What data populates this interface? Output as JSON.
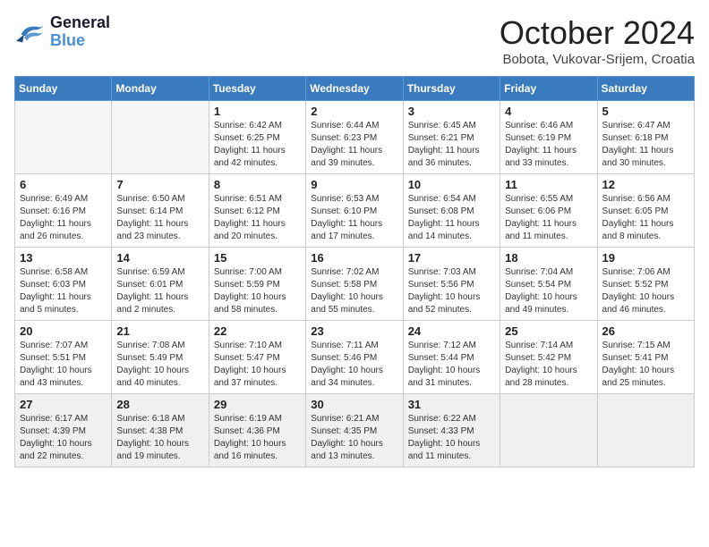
{
  "logo": {
    "line1": "General",
    "line2": "Blue"
  },
  "title": "October 2024",
  "subtitle": "Bobota, Vukovar-Srijem, Croatia",
  "headers": [
    "Sunday",
    "Monday",
    "Tuesday",
    "Wednesday",
    "Thursday",
    "Friday",
    "Saturday"
  ],
  "weeks": [
    [
      {
        "day": "",
        "empty": true
      },
      {
        "day": "",
        "empty": true
      },
      {
        "day": "1",
        "sunrise": "6:42 AM",
        "sunset": "6:25 PM",
        "daylight": "11 hours and 42 minutes."
      },
      {
        "day": "2",
        "sunrise": "6:44 AM",
        "sunset": "6:23 PM",
        "daylight": "11 hours and 39 minutes."
      },
      {
        "day": "3",
        "sunrise": "6:45 AM",
        "sunset": "6:21 PM",
        "daylight": "11 hours and 36 minutes."
      },
      {
        "day": "4",
        "sunrise": "6:46 AM",
        "sunset": "6:19 PM",
        "daylight": "11 hours and 33 minutes."
      },
      {
        "day": "5",
        "sunrise": "6:47 AM",
        "sunset": "6:18 PM",
        "daylight": "11 hours and 30 minutes."
      }
    ],
    [
      {
        "day": "6",
        "sunrise": "6:49 AM",
        "sunset": "6:16 PM",
        "daylight": "11 hours and 26 minutes."
      },
      {
        "day": "7",
        "sunrise": "6:50 AM",
        "sunset": "6:14 PM",
        "daylight": "11 hours and 23 minutes."
      },
      {
        "day": "8",
        "sunrise": "6:51 AM",
        "sunset": "6:12 PM",
        "daylight": "11 hours and 20 minutes."
      },
      {
        "day": "9",
        "sunrise": "6:53 AM",
        "sunset": "6:10 PM",
        "daylight": "11 hours and 17 minutes."
      },
      {
        "day": "10",
        "sunrise": "6:54 AM",
        "sunset": "6:08 PM",
        "daylight": "11 hours and 14 minutes."
      },
      {
        "day": "11",
        "sunrise": "6:55 AM",
        "sunset": "6:06 PM",
        "daylight": "11 hours and 11 minutes."
      },
      {
        "day": "12",
        "sunrise": "6:56 AM",
        "sunset": "6:05 PM",
        "daylight": "11 hours and 8 minutes."
      }
    ],
    [
      {
        "day": "13",
        "sunrise": "6:58 AM",
        "sunset": "6:03 PM",
        "daylight": "11 hours and 5 minutes."
      },
      {
        "day": "14",
        "sunrise": "6:59 AM",
        "sunset": "6:01 PM",
        "daylight": "11 hours and 2 minutes."
      },
      {
        "day": "15",
        "sunrise": "7:00 AM",
        "sunset": "5:59 PM",
        "daylight": "10 hours and 58 minutes."
      },
      {
        "day": "16",
        "sunrise": "7:02 AM",
        "sunset": "5:58 PM",
        "daylight": "10 hours and 55 minutes."
      },
      {
        "day": "17",
        "sunrise": "7:03 AM",
        "sunset": "5:56 PM",
        "daylight": "10 hours and 52 minutes."
      },
      {
        "day": "18",
        "sunrise": "7:04 AM",
        "sunset": "5:54 PM",
        "daylight": "10 hours and 49 minutes."
      },
      {
        "day": "19",
        "sunrise": "7:06 AM",
        "sunset": "5:52 PM",
        "daylight": "10 hours and 46 minutes."
      }
    ],
    [
      {
        "day": "20",
        "sunrise": "7:07 AM",
        "sunset": "5:51 PM",
        "daylight": "10 hours and 43 minutes."
      },
      {
        "day": "21",
        "sunrise": "7:08 AM",
        "sunset": "5:49 PM",
        "daylight": "10 hours and 40 minutes."
      },
      {
        "day": "22",
        "sunrise": "7:10 AM",
        "sunset": "5:47 PM",
        "daylight": "10 hours and 37 minutes."
      },
      {
        "day": "23",
        "sunrise": "7:11 AM",
        "sunset": "5:46 PM",
        "daylight": "10 hours and 34 minutes."
      },
      {
        "day": "24",
        "sunrise": "7:12 AM",
        "sunset": "5:44 PM",
        "daylight": "10 hours and 31 minutes."
      },
      {
        "day": "25",
        "sunrise": "7:14 AM",
        "sunset": "5:42 PM",
        "daylight": "10 hours and 28 minutes."
      },
      {
        "day": "26",
        "sunrise": "7:15 AM",
        "sunset": "5:41 PM",
        "daylight": "10 hours and 25 minutes."
      }
    ],
    [
      {
        "day": "27",
        "sunrise": "6:17 AM",
        "sunset": "4:39 PM",
        "daylight": "10 hours and 22 minutes."
      },
      {
        "day": "28",
        "sunrise": "6:18 AM",
        "sunset": "4:38 PM",
        "daylight": "10 hours and 19 minutes."
      },
      {
        "day": "29",
        "sunrise": "6:19 AM",
        "sunset": "4:36 PM",
        "daylight": "10 hours and 16 minutes."
      },
      {
        "day": "30",
        "sunrise": "6:21 AM",
        "sunset": "4:35 PM",
        "daylight": "10 hours and 13 minutes."
      },
      {
        "day": "31",
        "sunrise": "6:22 AM",
        "sunset": "4:33 PM",
        "daylight": "10 hours and 11 minutes."
      },
      {
        "day": "",
        "empty": true
      },
      {
        "day": "",
        "empty": true
      }
    ]
  ]
}
